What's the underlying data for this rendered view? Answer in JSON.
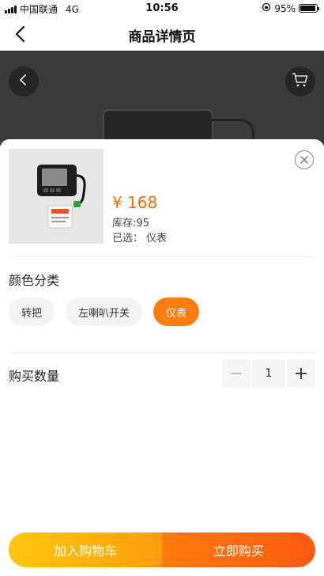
{
  "status_bar": {
    "carrier": "中国联通",
    "network": "4G",
    "time": "10:56",
    "battery": "95%"
  },
  "nav": {
    "title": "商品详情页"
  },
  "product": {
    "price": "¥ 168",
    "stock": "库存:95",
    "selected_label": "已选：",
    "selected_value": "仪表"
  },
  "spec": {
    "title": "颜色分类",
    "options": [
      "转把",
      "左喇叭开关",
      "仪表"
    ],
    "active_index": 2
  },
  "quantity": {
    "title": "购买数量",
    "value": "1",
    "minus": "−",
    "plus": "+"
  },
  "actions": {
    "add_to_cart": "加入购物车",
    "buy_now": "立即购买"
  },
  "colors": {
    "accent": "#ff6a00",
    "chip_active": "#ff7d0f"
  },
  "icons": [
    "back-arrow-icon",
    "chevron-left-icon",
    "cart-icon",
    "close-icon",
    "signal-icon",
    "battery-icon",
    "orientation-lock-icon"
  ]
}
